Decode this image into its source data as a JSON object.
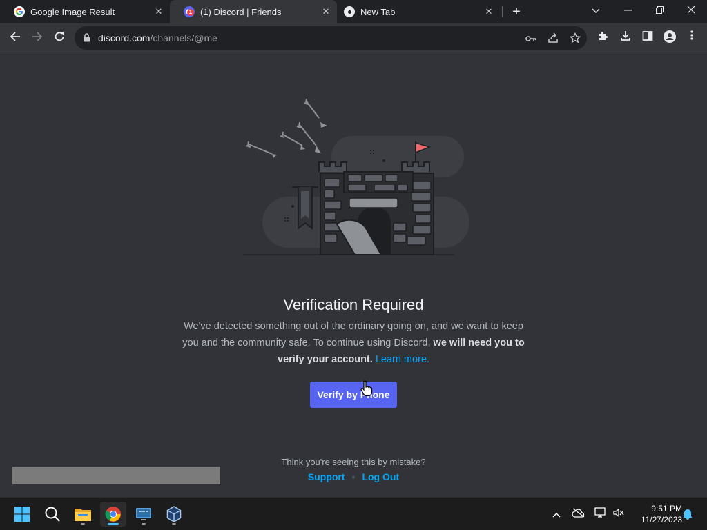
{
  "browser": {
    "tabs": [
      {
        "title": "Google Image Result",
        "favicon": "google-icon",
        "active": false
      },
      {
        "title": "(1) Discord | Friends",
        "favicon": "discord-icon",
        "badge": "1",
        "active": true
      },
      {
        "title": "New Tab",
        "favicon": "chrome-icon",
        "active": false
      }
    ],
    "close_glyph": "✕",
    "newtab_glyph": "+",
    "address": {
      "domain": "discord.com",
      "path": "/channels/@me"
    }
  },
  "page": {
    "heading": "Verification Required",
    "description_part1": "We've detected something out of the ordinary going on, and we want to keep you and the community safe. To continue using Discord, ",
    "description_bold": "we will need you to verify your account.",
    "learn_more": "Learn more.",
    "verify_button": "Verify by Phone",
    "mistake_text": "Think you're seeing this by mistake?",
    "support_link": "Support",
    "separator": "•",
    "logout_link": "Log Out"
  },
  "taskbar": {
    "time": "9:51 PM",
    "date": "11/27/2023"
  },
  "colors": {
    "background": "#313338",
    "accent": "#5865f2",
    "link": "#00a8fc"
  }
}
